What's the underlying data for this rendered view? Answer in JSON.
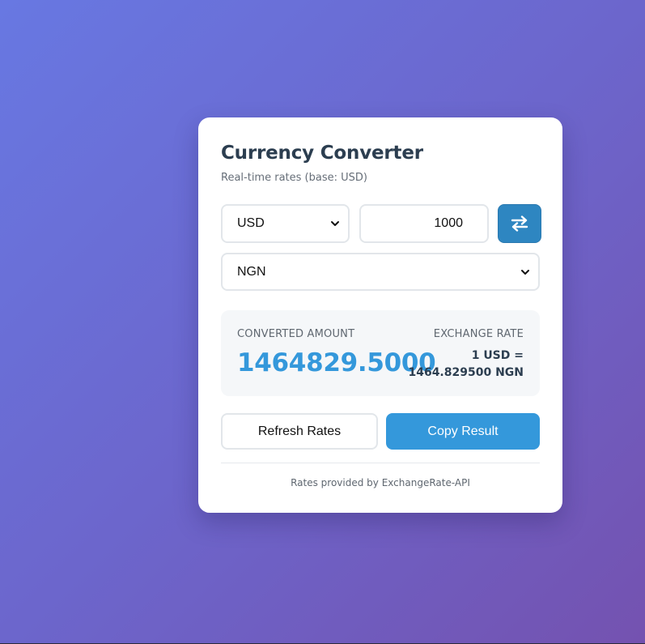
{
  "converter": {
    "title": "Currency Converter",
    "subtitle": "Real-time rates (base: USD)",
    "from_currency": "USD",
    "amount": "1000",
    "to_currency": "NGN",
    "swap_icon": "swap-arrows-icon"
  },
  "result": {
    "converted_label": "CONVERTED AMOUNT",
    "converted_value": "1464829.5000",
    "rate_label": "EXCHANGE RATE",
    "rate_line1": "1 USD =",
    "rate_line2": "1464.829500 NGN"
  },
  "actions": {
    "refresh_label": "Refresh Rates",
    "copy_label": "Copy Result"
  },
  "footer": {
    "text": "Rates provided by ExchangeRate-API"
  },
  "colors": {
    "accent": "#3498db",
    "swap_button": "#2e86c1",
    "title": "#2c3e50",
    "background_start": "#6878e2",
    "background_end": "#7452b0"
  }
}
